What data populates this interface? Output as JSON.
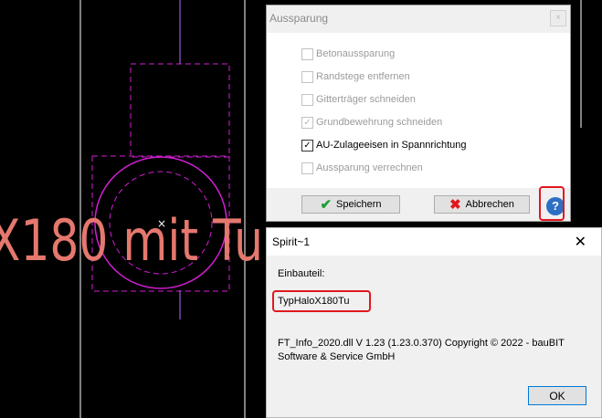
{
  "cad": {
    "text": "X180 mit Tu"
  },
  "aussparung": {
    "title": "Aussparung",
    "close_label": "×",
    "options": [
      {
        "label": "Betonaussparung",
        "checked": false,
        "enabled": false
      },
      {
        "label": "Randstege entfernen",
        "checked": false,
        "enabled": false
      },
      {
        "label": "Gitterträger schneiden",
        "checked": false,
        "enabled": false
      },
      {
        "label": "Grundbewehrung schneiden",
        "checked": true,
        "enabled": false
      },
      {
        "label": "AU-Zulageeisen in Spannrichtung",
        "checked": true,
        "enabled": true
      },
      {
        "label": "Aussparung verrechnen",
        "checked": false,
        "enabled": false
      }
    ],
    "save_label": "Speichern",
    "cancel_label": "Abbrechen",
    "help_label": "?"
  },
  "spirit": {
    "title": "Spirit~1",
    "close_label": "✕",
    "einbauteil_label": "Einbauteil:",
    "einbauteil_value": "TypHaloX180Tu",
    "info_line1": "FT_Info_2020.dll V 1.23 (1.23.0.370)     Copyright © 2022 - bauBIT",
    "info_line2": "Software & Service GmbH",
    "ok_label": "OK"
  },
  "colors": {
    "accent_red": "#e0181e",
    "cad_magenta": "#d21ed2",
    "cad_text": "#e5786e"
  }
}
